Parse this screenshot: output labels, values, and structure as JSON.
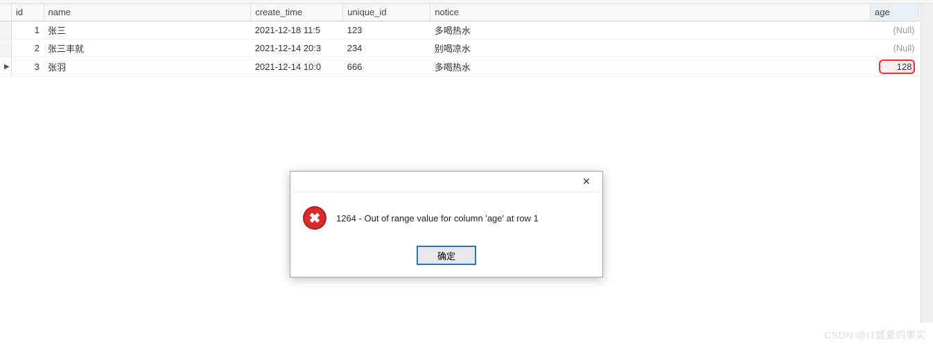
{
  "columns": {
    "id": "id",
    "name": "name",
    "create_time": "create_time",
    "unique_id": "unique_id",
    "notice": "notice",
    "age": "age"
  },
  "rows": [
    {
      "marker": "",
      "id": "1",
      "name": "张三",
      "create_time": "2021-12-18 11:5",
      "unique_id": "123",
      "notice": "多喝热水",
      "age": "(Null)",
      "age_null": true,
      "active": false
    },
    {
      "marker": "",
      "id": "2",
      "name": "张三丰就",
      "create_time": "2021-12-14 20:3",
      "unique_id": "234",
      "notice": "别喝凉水",
      "age": "(Null)",
      "age_null": true,
      "active": false
    },
    {
      "marker": "▶",
      "id": "3",
      "name": "张羽",
      "create_time": "2021-12-14 10:0",
      "unique_id": "666",
      "notice": "多喝热水",
      "age": "128",
      "age_null": false,
      "active": true,
      "highlight_age": true
    }
  ],
  "dialog": {
    "message": "1264 - Out of range value for column 'age' at row 1",
    "ok_label": "确定",
    "close_symbol": "✕",
    "error_symbol": "✖"
  },
  "watermark": "CSDN @IT盛夏的果实"
}
